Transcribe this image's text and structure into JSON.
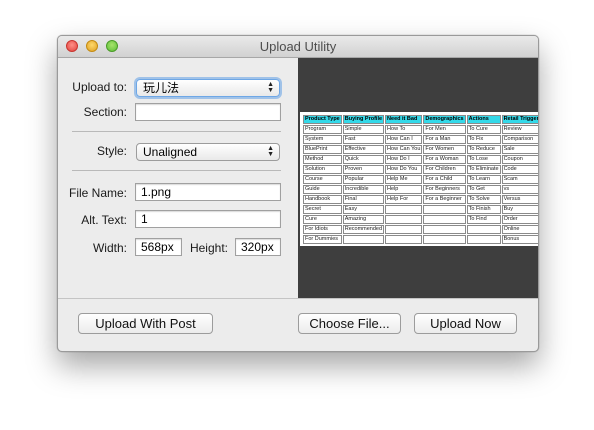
{
  "window": {
    "title": "Upload Utility"
  },
  "form": {
    "upload_to_label": "Upload to:",
    "upload_to_value": "玩儿法",
    "section_label": "Section:",
    "section_value": "",
    "style_label": "Style:",
    "style_value": "Unaligned",
    "file_name_label": "File Name:",
    "file_name_value": "1.png",
    "alt_text_label": "Alt. Text:",
    "alt_text_value": "1",
    "width_label": "Width:",
    "width_value": "568px",
    "height_label": "Height:",
    "height_value": "320px"
  },
  "preview_table": {
    "headers": [
      "Product Type",
      "Buying Profile",
      "Need it Bad",
      "Demographics",
      "Actions",
      "Retail Triggers"
    ],
    "rows": [
      [
        "Program",
        "Simple",
        "How To",
        "For Men",
        "To Cure",
        "Review"
      ],
      [
        "System",
        "Fast",
        "How Can I",
        "For a Man",
        "To Fix",
        "Comparison"
      ],
      [
        "BluePrint",
        "Effective",
        "How Can You",
        "For Women",
        "To Reduce",
        "Sale"
      ],
      [
        "Method",
        "Quick",
        "How Do I",
        "For a Woman",
        "To Lose",
        "Coupon"
      ],
      [
        "Solution",
        "Proven",
        "How Do You",
        "For Children",
        "To Eliminate",
        "Code"
      ],
      [
        "Course",
        "Popular",
        "Help Me",
        "For a Child",
        "To Learn",
        "Scam"
      ],
      [
        "Guide",
        "Incredible",
        "Help",
        "For Beginners",
        "To Get",
        "vs"
      ],
      [
        "Handbook",
        "Final",
        "Help For",
        "For a Beginner",
        "To Solve",
        "Versus"
      ],
      [
        "Secret",
        "Easy",
        "",
        "",
        "To Finish",
        "Buy"
      ],
      [
        "Cure",
        "Amazing",
        "",
        "",
        "To Find",
        "Order"
      ],
      [
        "For Idiots",
        "Recommended",
        "",
        "",
        "",
        "Online"
      ],
      [
        "For Dummies",
        "",
        "",
        "",
        "",
        "Bonus"
      ]
    ]
  },
  "buttons": {
    "upload_with_post": "Upload With Post",
    "choose_file": "Choose File...",
    "upload_now": "Upload Now"
  }
}
